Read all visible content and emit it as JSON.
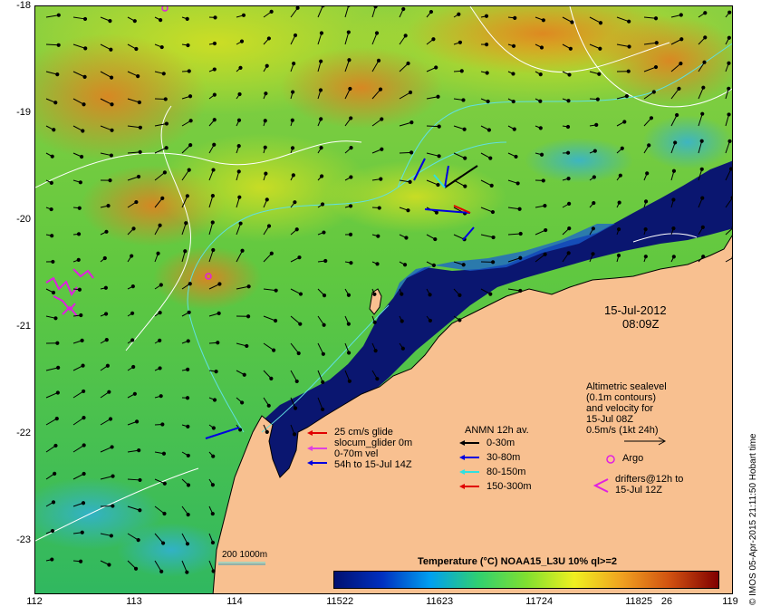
{
  "map": {
    "x_ticks": [
      "112",
      "113",
      "114",
      "115",
      "116",
      "117",
      "118",
      "119"
    ],
    "y_ticks": [
      "-18",
      "-19",
      "-20",
      "-21",
      "-22",
      "-23"
    ],
    "date": "15-Jul-2012",
    "time": "08:09Z",
    "credit": "© IMOS 05-Apr-2015 21:11:50 Hobart time",
    "colors": {
      "land": "#f8c090",
      "ocean_deep": "#0a1670",
      "ocean_mid": "#2cc050",
      "ocean_warm": "#f0a020"
    }
  },
  "legend": {
    "glider": {
      "line1": "25 cm/s glide",
      "line2": "slocum_glider 0m",
      "line3": "0-70m vel",
      "line4": "54h to 15-Jul 14Z",
      "colors": [
        "#e00000",
        "#e040e0",
        "#0000e0"
      ]
    },
    "anmn": {
      "title": "ANMN 12h av.",
      "items": [
        "0-30m",
        "30-80m",
        "80-150m",
        "150-300m"
      ],
      "colors": [
        "#000000",
        "#0000e0",
        "#30e0e0",
        "#e00000"
      ]
    },
    "altimetric": {
      "line1": "Altimetric sealevel",
      "line2": "(0.1m contours)",
      "line3": "and velocity for",
      "line4": "15-Jul 08Z",
      "line5": "0.5m/s (1kt 24h)"
    },
    "argo": "Argo",
    "drifters": {
      "line1": "drifters@12h to",
      "line2": "15-Jul 12Z"
    },
    "bathy": "200  1000m"
  },
  "colorbar": {
    "title": "Temperature (°C) NOAA15_L3U 10% ql>=2",
    "ticks": [
      "22",
      "23",
      "24",
      "25",
      "26"
    ],
    "stops": [
      "#001070",
      "#0030c0",
      "#00a0f0",
      "#30d070",
      "#80e030",
      "#f0f020",
      "#f0a020",
      "#d05010",
      "#800000"
    ]
  }
}
